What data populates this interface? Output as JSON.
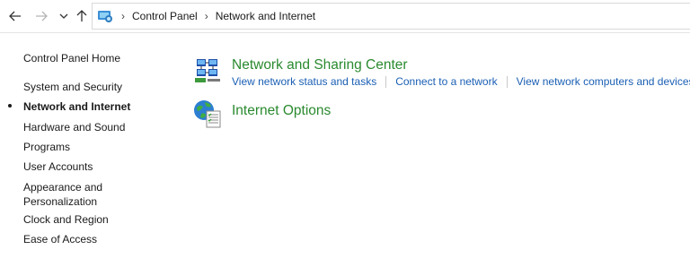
{
  "toolbar": {
    "back_icon": "arrow-left-icon",
    "forward_icon": "arrow-right-icon",
    "recent_icon": "chevron-down-icon",
    "up_icon": "arrow-up-icon"
  },
  "address_bar": {
    "icon": "control-panel-icon",
    "breadcrumbs": [
      "Control Panel",
      "Network and Internet"
    ]
  },
  "sidebar": {
    "home": "Control Panel Home",
    "items": [
      {
        "label": "System and Security",
        "active": false
      },
      {
        "label": "Network and Internet",
        "active": true
      },
      {
        "label": "Hardware and Sound",
        "active": false
      },
      {
        "label": "Programs",
        "active": false
      },
      {
        "label": "User Accounts",
        "active": false
      },
      {
        "label": "Appearance and",
        "label2": "Personalization",
        "active": false
      },
      {
        "label": "Clock and Region",
        "active": false
      },
      {
        "label": "Ease of Access",
        "active": false
      }
    ]
  },
  "categories": [
    {
      "title": "Network and Sharing Center",
      "icon": "network-sharing-center-icon",
      "tasks": [
        "View network status and tasks",
        "Connect to a network",
        "View network computers and devices"
      ]
    },
    {
      "title": "Internet Options",
      "icon": "internet-options-icon",
      "tasks": []
    }
  ],
  "colors": {
    "category_title": "#2a8a2f",
    "task_link": "#1a5fb4"
  }
}
